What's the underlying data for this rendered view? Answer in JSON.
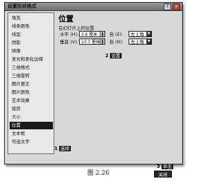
{
  "dialog": {
    "title": "设置形状格式",
    "help_label": "?",
    "close_label": "×"
  },
  "categories": [
    {
      "label": "填充",
      "selected": false
    },
    {
      "label": "线条颜色",
      "selected": false
    },
    {
      "label": "线型",
      "selected": false
    },
    {
      "label": "阴影",
      "selected": false
    },
    {
      "label": "映像",
      "selected": false
    },
    {
      "label": "发光和柔化边缘",
      "selected": false
    },
    {
      "label": "三维格式",
      "selected": false
    },
    {
      "label": "三维旋转",
      "selected": false
    },
    {
      "label": "图片更正",
      "selected": false
    },
    {
      "label": "图片颜色",
      "selected": false
    },
    {
      "label": "艺术效果",
      "selected": false
    },
    {
      "label": "裁剪",
      "selected": false
    },
    {
      "label": "大小",
      "selected": false
    },
    {
      "label": "位置",
      "selected": true
    },
    {
      "label": "文本框",
      "selected": false
    },
    {
      "label": "可选文字",
      "selected": false
    }
  ],
  "panel": {
    "title": "位置",
    "subtitle": "在幻灯片上的位置",
    "horizontal_label": "水平 (H):",
    "horizontal_value": "3.6 厘米",
    "horizontal_from_label": "自 (E):",
    "horizontal_from_value": "左上角",
    "vertical_label": "垂直 (V):",
    "vertical_value": "10.7 厘米",
    "vertical_from_label": "自 (R):",
    "vertical_from_value": "左上角"
  },
  "callouts": {
    "step1_num": "1",
    "step1_tag": "选择",
    "step2_num": "2",
    "step2_tag": "设置",
    "step3_num": "3",
    "step3_tag": "单击"
  },
  "buttons": {
    "close_label": "关闭"
  },
  "caption": "图 2.26"
}
